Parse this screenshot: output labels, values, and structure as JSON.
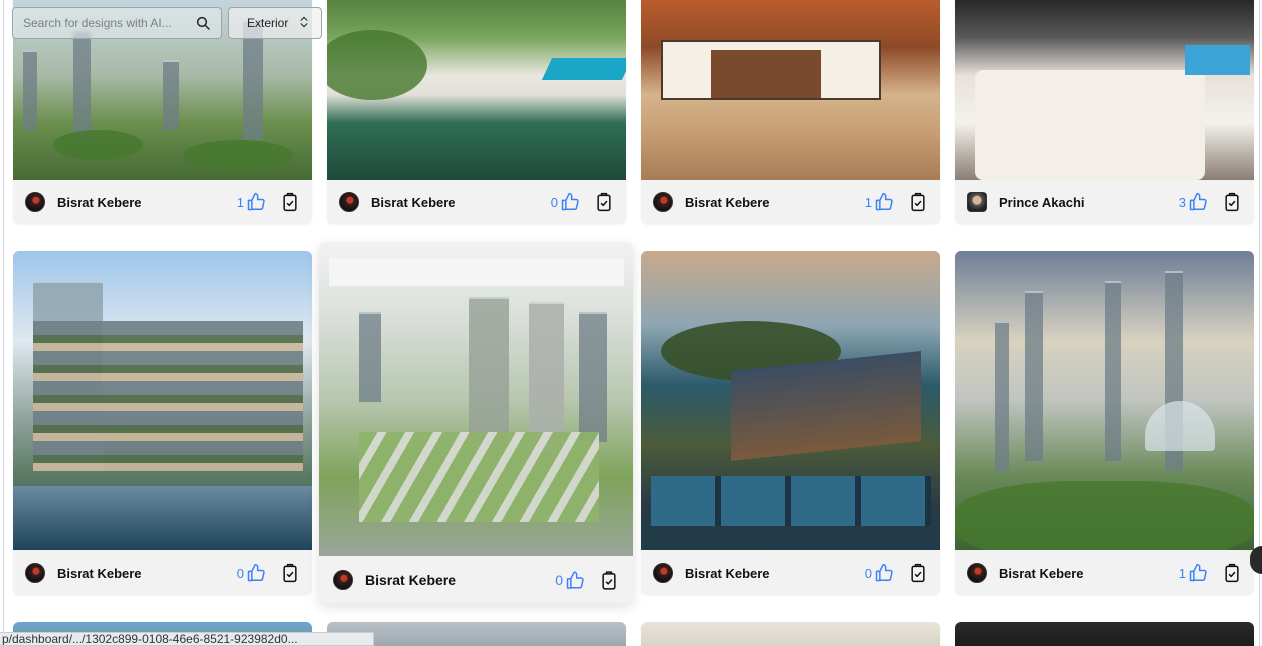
{
  "search": {
    "placeholder": "Search for designs with AI...",
    "value": ""
  },
  "filter": {
    "selected": "Exterior"
  },
  "status_bar": {
    "url": "p/dashboard/.../1302c899-0108-46e6-8521-923982d0..."
  },
  "cards": [
    {
      "author": "Bisrat Kebere",
      "likes": "1",
      "scene": "city"
    },
    {
      "author": "Bisrat Kebere",
      "likes": "0",
      "scene": "pool"
    },
    {
      "author": "Bisrat Kebere",
      "likes": "1",
      "scene": "desert"
    },
    {
      "author": "Prince Akachi",
      "likes": "3",
      "scene": "bedroom"
    },
    {
      "author": "Bisrat Kebere",
      "likes": "0",
      "scene": "building"
    },
    {
      "author": "Bisrat Kebere",
      "likes": "0",
      "scene": "greenCity"
    },
    {
      "author": "Bisrat Kebere",
      "likes": "0",
      "scene": "island"
    },
    {
      "author": "Bisrat Kebere",
      "likes": "1",
      "scene": "futurecity"
    }
  ],
  "icons": {
    "like": "thumbs-up-icon",
    "copy": "clipboard-check-icon",
    "search": "search-icon",
    "select": "chevron-up-down-icon"
  },
  "colors": {
    "like_count": "#3b82f6",
    "card_bg": "#f2f2f3"
  }
}
